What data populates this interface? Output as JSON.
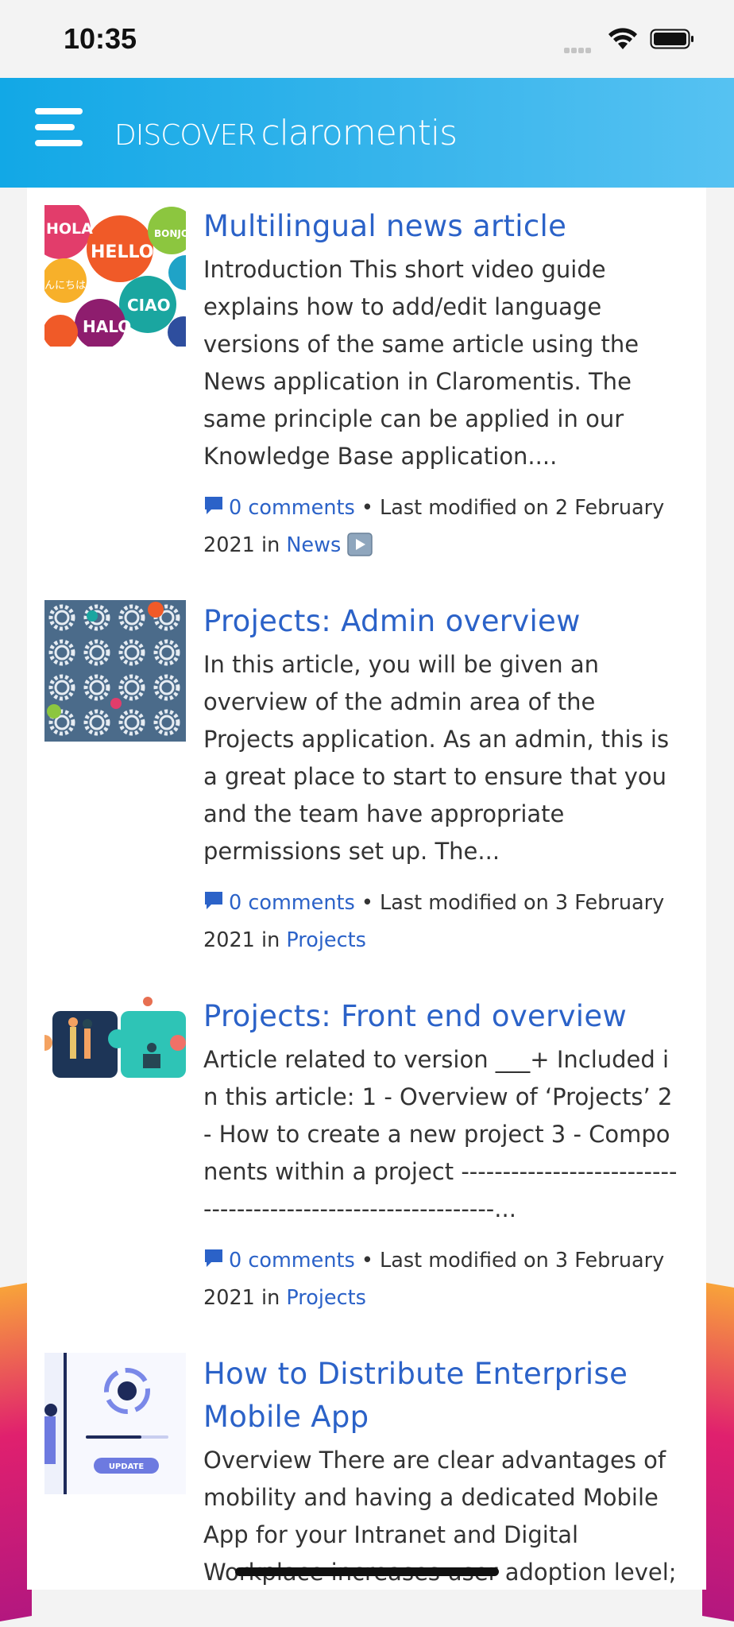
{
  "status_bar": {
    "time": "10:35",
    "icons": [
      "signal-dots-icon",
      "wifi-icon",
      "battery-icon"
    ]
  },
  "header": {
    "brand_prefix": "DISCOVER",
    "brand_name": "claromentis",
    "menu_icon": "hamburger-menu-icon",
    "colors": {
      "gradient_start": "#12a8e6",
      "gradient_end": "#56c2f2"
    }
  },
  "articles": [
    {
      "title": "Multilingual news article",
      "summary": "Introduction This short video guide explains how to add/edit language versions of the same article using the News application in Claromentis. The same principle can be applied in our Knowledge Base application....",
      "comments": "0 comments",
      "meta_text": " • Last modified on 2 February 2021 in ",
      "category": "News",
      "has_video": true,
      "thumbnail": "multilingual-greetings-image"
    },
    {
      "title": "Projects: Admin overview",
      "summary": "In this article, you will be given an overview of the admin area of the Projects application. As an admin, this is a great place to start to ensure that you and the team have appropriate permissions set up. The...",
      "comments": "0 comments",
      "meta_text": " • Last modified on 3 February 2021 in ",
      "category": "Projects",
      "has_video": false,
      "thumbnail": "gears-pattern-image"
    },
    {
      "title": "Projects: Front end overview",
      "summary": "Article related to version ___+ Included in this article: 1 - Overview of ‘Projects’ 2 - How to create a new project 3 - Components within a project -------------------------------------------------------------...",
      "comments": "0 comments",
      "meta_text": " • Last modified on 3 February 2021 in ",
      "category": "Projects",
      "has_video": false,
      "thumbnail": "puzzle-team-image"
    },
    {
      "title": "How to Distribute Enterprise Mobile App",
      "summary": "Overview There are clear advantages of mobility and having a dedicated Mobile App for your Intranet and Digital Workplace increases user adoption level;",
      "thumbnail": "app-update-image",
      "update_label": "UPDATE"
    }
  ],
  "colors": {
    "link": "#2b62c8",
    "text": "#333333",
    "background": "#f3f3f3"
  }
}
